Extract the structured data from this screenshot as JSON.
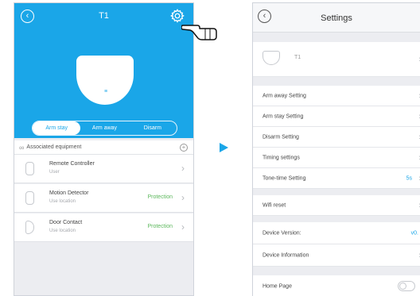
{
  "left": {
    "title": "T1",
    "modes": [
      "Arm stay",
      "Arm away",
      "Disarm"
    ],
    "active_mode": "Arm stay",
    "associated_label": "Associated equipment",
    "devices": [
      {
        "name": "Remote Controller",
        "sub": "User",
        "status": ""
      },
      {
        "name": "Motion Detector",
        "sub": "Use location",
        "status": "Protection"
      },
      {
        "name": "Door Contact",
        "sub": "Use location",
        "status": "Protection"
      }
    ]
  },
  "right": {
    "title": "Settings",
    "device_name": "T1",
    "settings": [
      {
        "label": "Arm away Setting"
      },
      {
        "label": "Arm stay Setting"
      },
      {
        "label": "Disarm Setting"
      },
      {
        "label": "Timing settings"
      },
      {
        "label": "Tone-time Setting",
        "value": "5s"
      }
    ],
    "wifi_reset": "Wifi reset",
    "device_version_label": "Device Version:",
    "device_version_value": "v0.",
    "device_information": "Device Information",
    "home_page": "Home Page",
    "home_page_enabled": false
  },
  "colors": {
    "accent": "#1aa6e8",
    "status_green": "#5cb85c",
    "background": "#ecedf1"
  },
  "icons": {
    "back": "back-circle-icon",
    "gear": "gear-icon",
    "hand": "pointing-hand-icon",
    "link": "link-icon",
    "add": "add-circle-icon",
    "chevron": "chevron-right-icon",
    "arrow": "right-arrow-icon"
  }
}
